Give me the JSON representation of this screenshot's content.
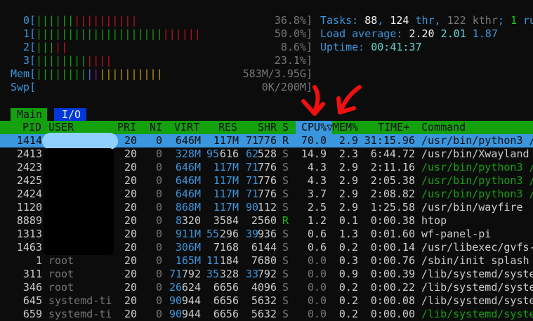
{
  "cpu_meters": [
    {
      "label": "0[",
      "bars": [
        {
          "text": "||||||",
          "color": "g"
        },
        {
          "text": "||||||||||",
          "color": "r"
        }
      ],
      "value": "36.8%]"
    },
    {
      "label": "1[",
      "bars": [
        {
          "text": "||||||||||||||||||||",
          "color": "g"
        },
        {
          "text": "||||||",
          "color": "r"
        }
      ],
      "value": "50.0%]"
    },
    {
      "label": "2[",
      "bars": [
        {
          "text": "|||",
          "color": "g"
        },
        {
          "text": "||",
          "color": "r"
        }
      ],
      "value": "8.6%]"
    },
    {
      "label": "3[",
      "bars": [
        {
          "text": "||||||||",
          "color": "g"
        },
        {
          "text": "||||",
          "color": "r"
        }
      ],
      "value": "23.1%]"
    }
  ],
  "mem_meter": {
    "label": "Mem[",
    "value": "583M/3.95G]"
  },
  "swp_meter": {
    "label": "Swp[",
    "value": "0K/200M]"
  },
  "summary": {
    "tasks_label": "Tasks: ",
    "tasks": "88",
    "sep1": ", ",
    "threads": "124",
    "thr_label": " thr",
    "sep2": ", ",
    "kthr": "122 kthr",
    "sep3": "; ",
    "running": "1",
    "running_label": " ru",
    "load_label": "Load average: ",
    "load1": "2.20",
    "load5": "2.01",
    "load15": "1.87",
    "uptime_label": "Uptime: ",
    "uptime": "00:41:37"
  },
  "tabs": {
    "main": "Main",
    "io": "I/O"
  },
  "columns": {
    "pid": "PID",
    "user": "USER",
    "pri": "PRI",
    "ni": "NI",
    "virt": "VIRT",
    "res": "RES",
    "shr": "SHR",
    "s": "S",
    "cpu": "CPU%▽",
    "mem": "MEM%",
    "time": "TIME+",
    "command": "Command"
  },
  "processes": [
    {
      "pid": "1414",
      "user": "",
      "pri": "20",
      "ni": "0",
      "virt_a": "646M",
      "virt_b": "",
      "res_a": "117M",
      "res_b": "",
      "shr_a": "71",
      "shr_b": "776",
      "s": "R",
      "cpu": "70.0",
      "mem": "2.9",
      "time": "31:15.96",
      "cmd": "/usr/bin/python3 /",
      "cmd_color": "w",
      "selected": true
    },
    {
      "pid": "2413",
      "user": "",
      "pri": "20",
      "ni": "0",
      "virt_a": "328M",
      "virt_b": "",
      "res_a": "95",
      "res_b": "616",
      "shr_a": "62",
      "shr_b": "528",
      "s": "S",
      "cpu": "14.9",
      "mem": "2.3",
      "time": "6:44.72",
      "cmd": "/usr/bin/Xwayland",
      "cmd_color": "w"
    },
    {
      "pid": "2423",
      "user": "",
      "pri": "20",
      "ni": "0",
      "virt_a": "646M",
      "virt_b": "",
      "res_a": "117M",
      "res_b": "",
      "shr_a": "71",
      "shr_b": "776",
      "s": "S",
      "cpu": "4.3",
      "mem": "2.9",
      "time": "2:11.16",
      "cmd": "/usr/bin/python3 /",
      "cmd_color": "g"
    },
    {
      "pid": "2425",
      "user": "",
      "pri": "20",
      "ni": "0",
      "virt_a": "646M",
      "virt_b": "",
      "res_a": "117M",
      "res_b": "",
      "shr_a": "71",
      "shr_b": "776",
      "s": "S",
      "cpu": "4.3",
      "mem": "2.9",
      "time": "2:05.38",
      "cmd": "/usr/bin/python3 /",
      "cmd_color": "g"
    },
    {
      "pid": "2424",
      "user": "",
      "pri": "20",
      "ni": "0",
      "virt_a": "646M",
      "virt_b": "",
      "res_a": "117M",
      "res_b": "",
      "shr_a": "71",
      "shr_b": "776",
      "s": "S",
      "cpu": "3.7",
      "mem": "2.9",
      "time": "2:08.82",
      "cmd": "/usr/bin/python3 /",
      "cmd_color": "g"
    },
    {
      "pid": "1120",
      "user": "",
      "pri": "20",
      "ni": "0",
      "virt_a": "868M",
      "virt_b": "",
      "res_a": "117M",
      "res_b": "",
      "shr_a": "90",
      "shr_b": "112",
      "s": "S",
      "cpu": "2.5",
      "mem": "2.9",
      "time": "1:25.58",
      "cmd": "/usr/bin/wayfire",
      "cmd_color": "w"
    },
    {
      "pid": "8889",
      "user": "",
      "pri": "20",
      "ni": "0",
      "virt_a": "8",
      "virt_b": "320",
      "res_a": "3584",
      "res_b": "",
      "shr_a": "2560",
      "shr_b": "",
      "s": "R",
      "cpu": "1.2",
      "mem": "0.1",
      "time": "0:00.38",
      "cmd": "htop",
      "cmd_color": "w"
    },
    {
      "pid": "1313",
      "user": "",
      "pri": "20",
      "ni": "0",
      "virt_a": "911M",
      "virt_b": "",
      "res_a": "55",
      "res_b": "296",
      "shr_a": "39",
      "shr_b": "936",
      "s": "S",
      "cpu": "0.6",
      "mem": "1.3",
      "time": "0:01.60",
      "cmd": "wf-panel-pi",
      "cmd_color": "w"
    },
    {
      "pid": "1463",
      "user": "",
      "pri": "20",
      "ni": "0",
      "virt_a": "306M",
      "virt_b": "",
      "res_a": "7168",
      "res_b": "",
      "shr_a": "6144",
      "shr_b": "",
      "s": "S",
      "cpu": "0.6",
      "mem": "0.2",
      "time": "0:00.14",
      "cmd": "/usr/libexec/gvfs-",
      "cmd_color": "w"
    },
    {
      "pid": "1",
      "user": "root",
      "pri": "20",
      "ni": "0",
      "virt_a": "165M",
      "virt_b": "",
      "res_a": "11",
      "res_b": "184",
      "shr_a": "7680",
      "shr_b": "",
      "s": "S",
      "cpu": "0.0",
      "mem": "0.3",
      "time": "0:00.76",
      "cmd": "/sbin/init splash",
      "cmd_color": "w"
    },
    {
      "pid": "311",
      "user": "root",
      "pri": "20",
      "ni": "0",
      "virt_a": "71",
      "virt_b": "792",
      "res_a": "35",
      "res_b": "328",
      "shr_a": "33",
      "shr_b": "792",
      "s": "S",
      "cpu": "0.0",
      "mem": "0.9",
      "time": "0:00.39",
      "cmd": "/lib/systemd/syste",
      "cmd_color": "w"
    },
    {
      "pid": "346",
      "user": "root",
      "pri": "20",
      "ni": "0",
      "virt_a": "26",
      "virt_b": "624",
      "res_a": "6656",
      "res_b": "",
      "shr_a": "4096",
      "shr_b": "",
      "s": "S",
      "cpu": "0.0",
      "mem": "0.2",
      "time": "0:00.22",
      "cmd": "/lib/systemd/syste",
      "cmd_color": "w"
    },
    {
      "pid": "645",
      "user": "systemd-ti",
      "pri": "20",
      "ni": "0",
      "virt_a": "90",
      "virt_b": "944",
      "res_a": "6656",
      "res_b": "",
      "shr_a": "5632",
      "shr_b": "",
      "s": "S",
      "cpu": "0.0",
      "mem": "0.2",
      "time": "0:00.08",
      "cmd": "/lib/systemd/syste",
      "cmd_color": "w"
    },
    {
      "pid": "659",
      "user": "systemd-ti",
      "pri": "20",
      "ni": "0",
      "virt_a": "90",
      "virt_b": "944",
      "res_a": "6656",
      "res_b": "",
      "shr_a": "5632",
      "shr_b": "",
      "s": "S",
      "cpu": "0.0",
      "mem": "0.2",
      "time": "0:00.00",
      "cmd": "/lib/systemd/syste",
      "cmd_color": "g"
    }
  ]
}
